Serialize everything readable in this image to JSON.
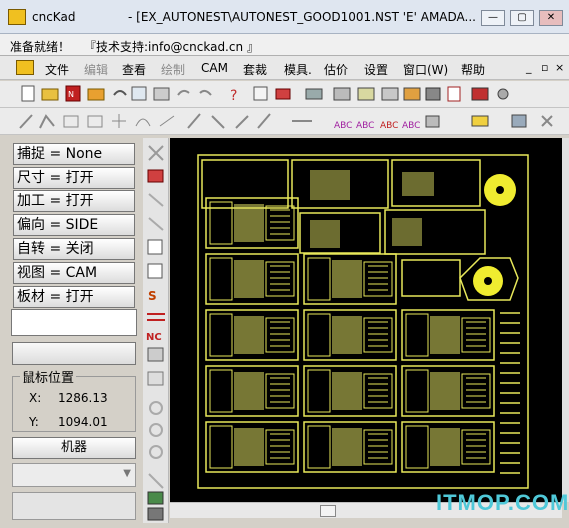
{
  "window": {
    "app_name": "cncKad",
    "document_title": "-  [EX_AUTONEST\\AUTONEST_GOOD1001.NST  'E'  AMADA...",
    "controls": [
      "—",
      "▢",
      "✕"
    ]
  },
  "status": {
    "ready": "准备就绪！",
    "support": "『技术支持:info@cnckad.cn 』"
  },
  "menu": {
    "items": [
      {
        "label": "文件",
        "enabled": true
      },
      {
        "label": "编辑",
        "enabled": false
      },
      {
        "label": "查看",
        "enabled": true
      },
      {
        "label": "绘制",
        "enabled": false
      },
      {
        "label": "CAM",
        "enabled": true
      },
      {
        "label": "套裁",
        "enabled": true
      },
      {
        "label": "模具.",
        "enabled": true
      },
      {
        "label": "估价",
        "enabled": true
      },
      {
        "label": "设置",
        "enabled": true
      },
      {
        "label": "窗口(W)",
        "enabled": true
      },
      {
        "label": "帮助",
        "enabled": true
      }
    ],
    "mdi": [
      "_",
      "▫",
      "×"
    ]
  },
  "panel": {
    "buttons": [
      "捕捉 = None",
      "尺寸 = 打开",
      "加工 = 打开",
      "偏向 = SIDE",
      "自转 = 关闭",
      "视图 = CAM",
      "板材 = 打开"
    ],
    "mouse_position_title": "鼠标位置",
    "x_label": "X:",
    "x_value": "1286.13",
    "y_label": "Y:",
    "y_value": "1094.01",
    "machine_button": "机器"
  },
  "watermark": "ITMOP.COM",
  "colors": {
    "part_outline": "#e8e85a",
    "fill_yellow": "#f0ec30",
    "canvas_bg": "#000000",
    "watermark": "#4fc8d8"
  }
}
